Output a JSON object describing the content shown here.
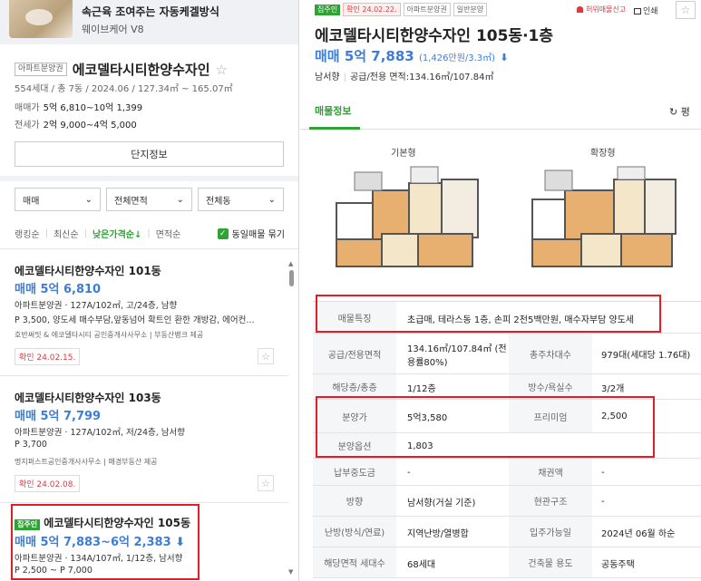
{
  "ad": {
    "title": "속근육 조여주는 자동케겔방식",
    "subtitle": "웨이브케어 V8"
  },
  "complex": {
    "type_badge": "아파트분양권",
    "name": "에코델타시티한양수자인",
    "star": "☆",
    "meta": "554세대 / 총 7동 / 2024.06 / 127.34㎡ ~ 165.07㎡",
    "sale_label": "매매가",
    "sale_value": "5억 6,810~10억 1,399",
    "jeonse_label": "전세가",
    "jeonse_value": "2억 9,000~4억 5,000",
    "info_button": "단지정보"
  },
  "filters": {
    "deal": "매매",
    "area": "전체면적",
    "dong": "전체동",
    "chevron": "⌄"
  },
  "sorts": {
    "items": [
      "랭킹순",
      "최신순",
      "낮은가격순↓",
      "면적순"
    ],
    "checkbox_label": "동일매물 묶기",
    "checkbox_mark": "✓"
  },
  "listings": [
    {
      "title": "에코델타시티한양수자인 101동",
      "price": "매매 5억 6,810",
      "spec": "아파트분양권 · 127A/102㎡, 고/24층, 남향",
      "desc": "P 3,500, 양도세 매수부담,앞동넘어 확트인 환한 개방감, 에어컨...",
      "source": "호반써밋 & 에코델타시티 공인중개사사무소 | 부동산뱅크 제공",
      "confirm": "확인 24.02.15.",
      "fav": "☆"
    },
    {
      "title": "에코델타시티한양수자인 103동",
      "price": "매매 5억 7,799",
      "spec": "아파트분양권 · 127A/102㎡, 저/24층, 남서향",
      "desc": "P 3,700",
      "source": "명지퍼스트공인중개사사무소 | 매경부동산 제공",
      "confirm": "확인 24.02.08.",
      "fav": "☆"
    },
    {
      "tag": "집주인",
      "title": "에코델타시티한양수자인 105동",
      "price": "매매 5억 7,883~6억 2,383",
      "price_arrow": "⬇",
      "spec": "아파트분양권 · 134A/107㎡, 1/12층, 남서향",
      "desc": "P 2,500 ~ P 7,000"
    }
  ],
  "scroll": {
    "up": "▲",
    "down": "▼"
  },
  "detail": {
    "tags": [
      "집주인",
      "확인 24.02.22.",
      "아파트분양권",
      "일반분양"
    ],
    "report": "허위매물신고",
    "print": "인쇄",
    "star": "☆",
    "title": "에코델타시티한양수자인 105동·1층",
    "price": "매매 5억 7,883",
    "price_sub": "(1,426만원/3.3㎡)",
    "price_arrow": "⬇",
    "direction": "남서향",
    "area": "공급/전용 면적:134.16㎡/107.84㎡",
    "tab": "매물정보",
    "tab_right": "↻ 평",
    "plan_basic": "기본형",
    "plan_ext": "확장형"
  },
  "table": {
    "feature_label": "매물특징",
    "feature_value": "초급매, 테라스동 1층, 손피 2천5백만원, 매수자부담 양도세",
    "rows": [
      {
        "l1": "공급/전용면적",
        "v1": "134.16㎡/107.84㎡ (전용률80%)",
        "l2": "총주차대수",
        "v2": "979대(세대당 1.76대)"
      },
      {
        "l1": "해당층/총층",
        "v1": "1/12층",
        "l2": "방수/욕실수",
        "v2": "3/2개"
      },
      {
        "l1": "분양가",
        "v1": "5억3,580",
        "l2": "프리미엄",
        "v2": "2,500"
      },
      {
        "l1": "분양옵션",
        "v1": "1,803",
        "l2": "",
        "v2": ""
      },
      {
        "l1": "납부중도금",
        "v1": "-",
        "l2": "채권액",
        "v2": "-"
      },
      {
        "l1": "방향",
        "v1": "남서향(거실 기준)",
        "l2": "현관구조",
        "v2": "-"
      },
      {
        "l1": "난방(방식/연료)",
        "v1": "지역난방/열병합",
        "l2": "입주가능일",
        "v2": "2024년 06월 하순"
      },
      {
        "l1": "해당면적 세대수",
        "v1": "68세대",
        "l2": "건축물 용도",
        "v2": "공동주택"
      }
    ]
  }
}
